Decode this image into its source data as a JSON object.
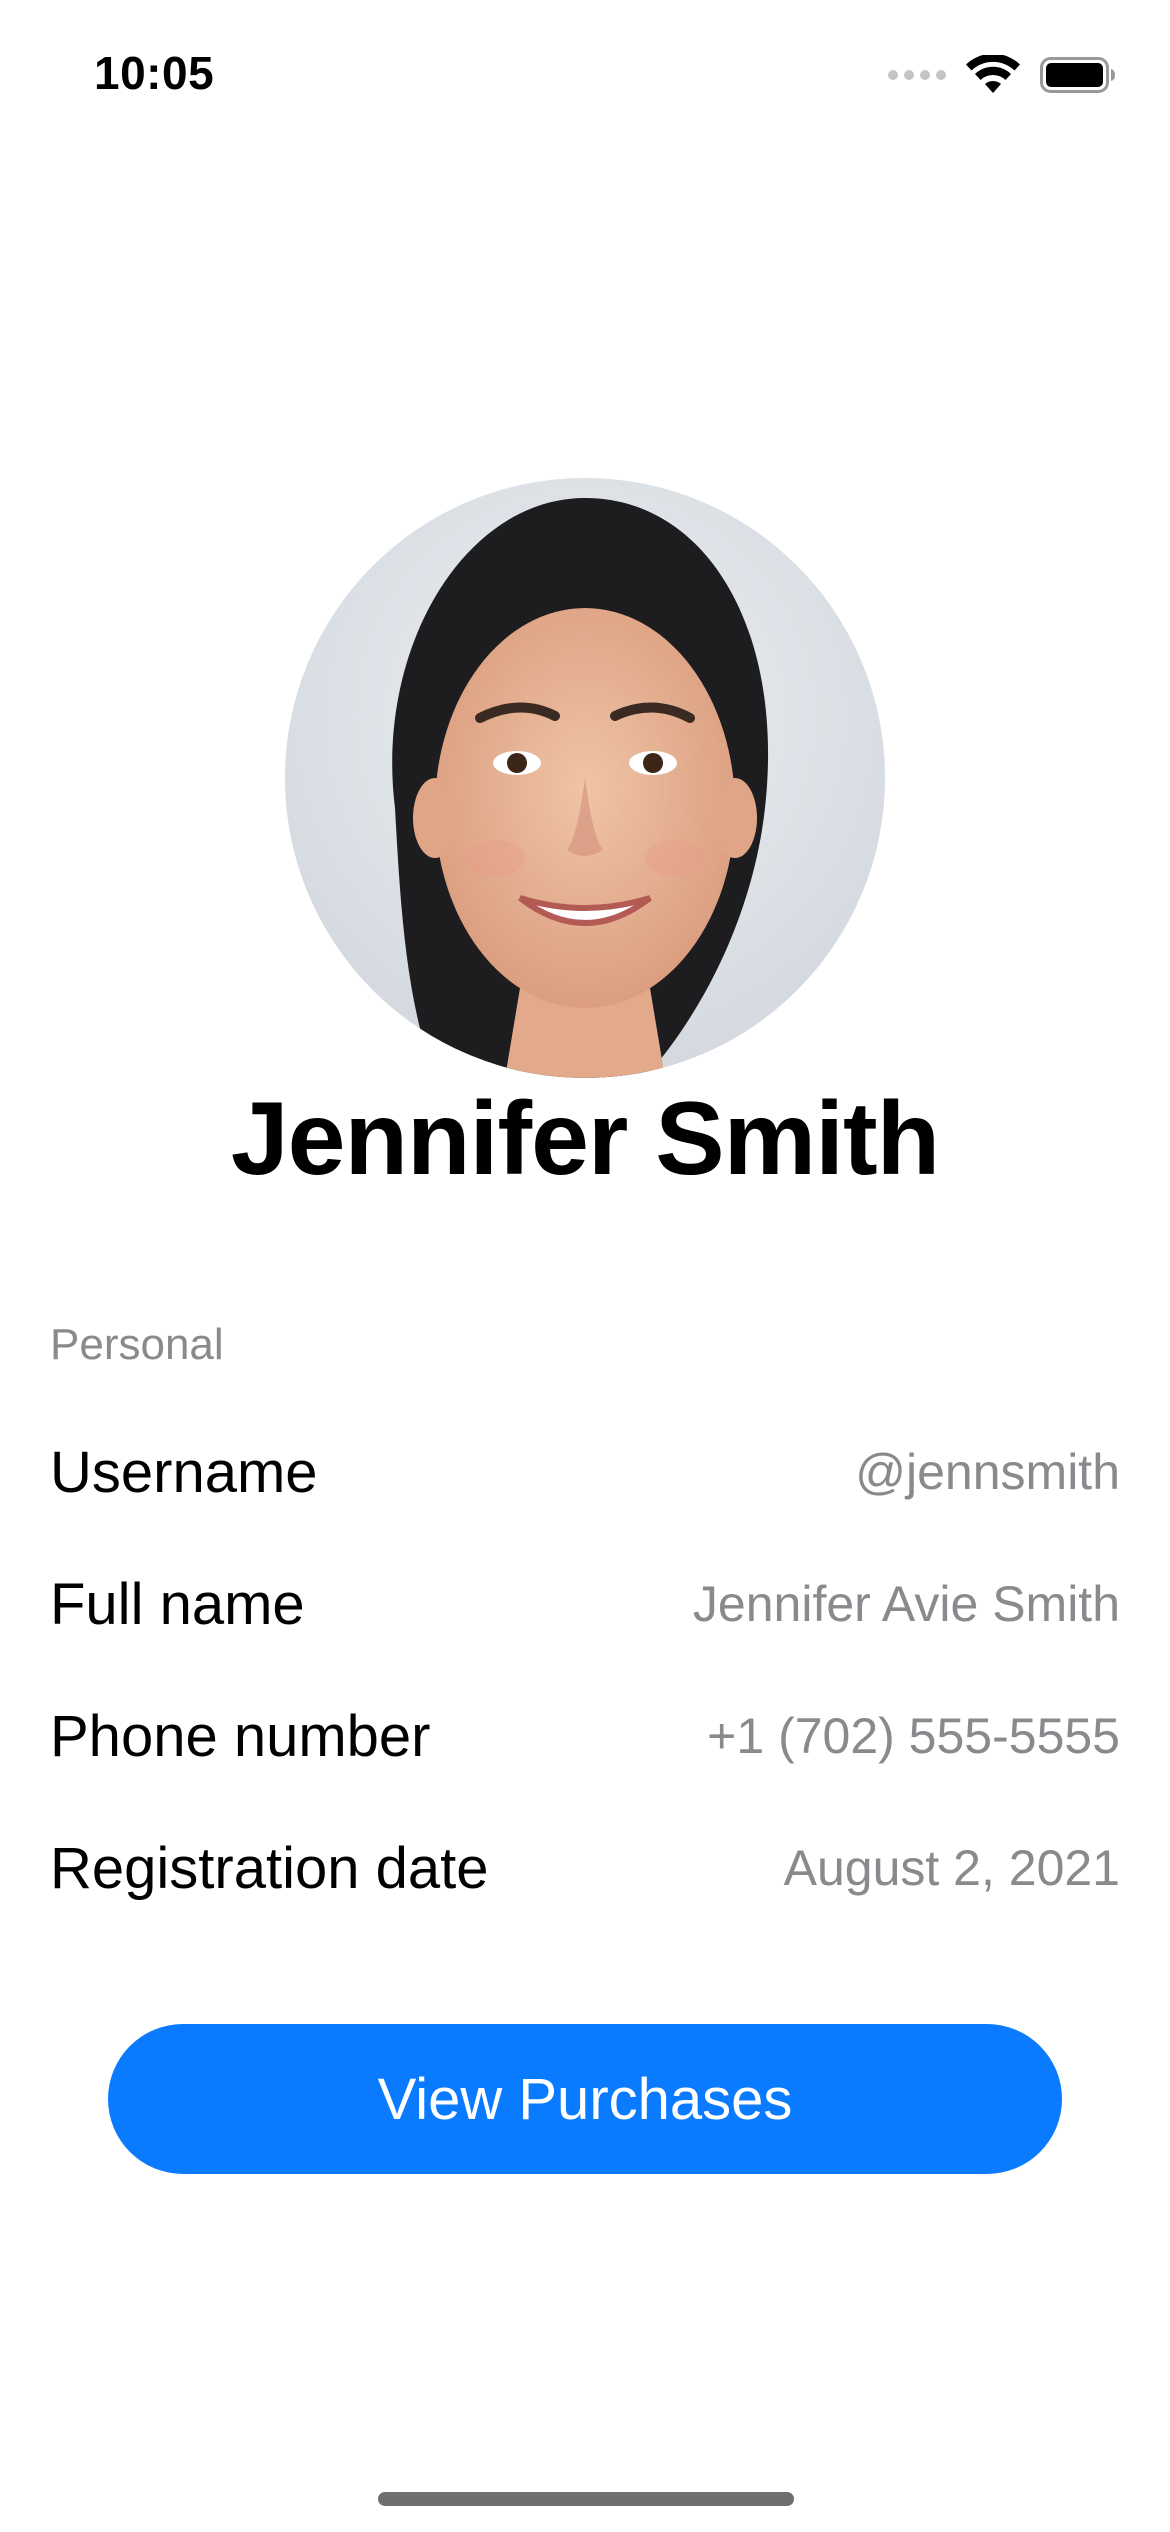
{
  "status_bar": {
    "time": "10:05",
    "icons": [
      "cellular-signal-icon",
      "wifi-icon",
      "battery-icon"
    ]
  },
  "profile": {
    "avatar": "profile-photo",
    "name": "Jennifer Smith"
  },
  "personal_section": {
    "header": "Personal",
    "rows": [
      {
        "label": "Username",
        "value": "@jennsmith"
      },
      {
        "label": "Full name",
        "value": "Jennifer Avie Smith"
      },
      {
        "label": "Phone number",
        "value": "+1 (702) 555-5555"
      },
      {
        "label": "Registration date",
        "value": "August 2, 2021"
      }
    ]
  },
  "actions": {
    "view_purchases_label": "View Purchases"
  },
  "colors": {
    "accent": "#0a7bff",
    "secondary_text": "#8a8a8e",
    "background": "#ffffff"
  }
}
